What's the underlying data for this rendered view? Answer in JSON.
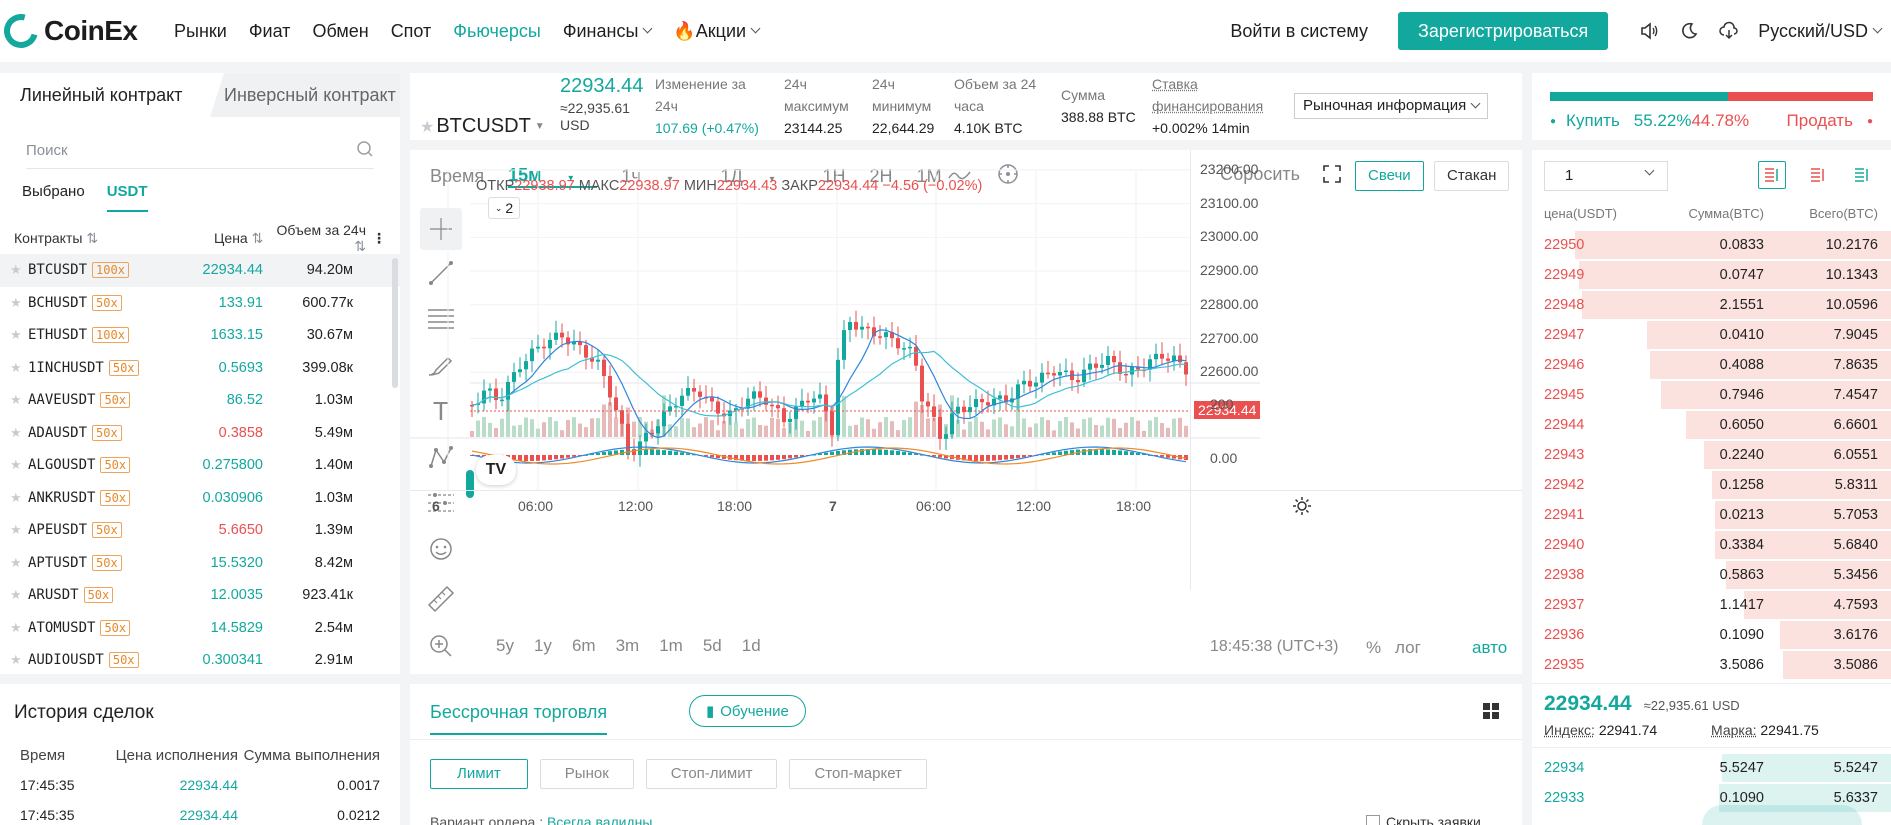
{
  "header": {
    "brand": "CoinEx",
    "nav": [
      {
        "label": "Рынки",
        "dropdown": false,
        "active": false
      },
      {
        "label": "Фиат",
        "dropdown": false,
        "active": false
      },
      {
        "label": "Обмен",
        "dropdown": false,
        "active": false
      },
      {
        "label": "Спот",
        "dropdown": false,
        "active": false
      },
      {
        "label": "Фьючерсы",
        "dropdown": false,
        "active": true
      },
      {
        "label": "Финансы",
        "dropdown": true,
        "active": false
      },
      {
        "label": "🔥Акции",
        "dropdown": true,
        "active": false
      }
    ],
    "login": "Войти в систему",
    "register": "Зарегистрироваться",
    "language": "Русский/USD",
    "icons": [
      "speaker-icon",
      "moon-icon",
      "download-icon"
    ]
  },
  "contracts": {
    "tab_linear": "Линейный контракт",
    "tab_inverse": "Инверсный контракт",
    "search_placeholder": "Поиск",
    "subtab_favorites": "Выбрано",
    "subtab_usdt": "USDT",
    "col_contracts": "Контракты",
    "col_price": "Цена",
    "col_volume": "Объем за 24ч",
    "rows": [
      {
        "symbol": "BTCUSDT",
        "leverage": "100x",
        "price": "22934.44",
        "dir": "green",
        "volume": "94.20м"
      },
      {
        "symbol": "BCHUSDT",
        "leverage": "50x",
        "price": "133.91",
        "dir": "green",
        "volume": "600.77к"
      },
      {
        "symbol": "ETHUSDT",
        "leverage": "100x",
        "price": "1633.15",
        "dir": "green",
        "volume": "30.67м"
      },
      {
        "symbol": "1INCHUSDT",
        "leverage": "50x",
        "price": "0.5693",
        "dir": "green",
        "volume": "399.08к"
      },
      {
        "symbol": "AAVEUSDT",
        "leverage": "50x",
        "price": "86.52",
        "dir": "green",
        "volume": "1.03м"
      },
      {
        "symbol": "ADAUSDT",
        "leverage": "50x",
        "price": "0.3858",
        "dir": "red",
        "volume": "5.49м"
      },
      {
        "symbol": "ALGOUSDT",
        "leverage": "50x",
        "price": "0.275800",
        "dir": "green",
        "volume": "1.40м"
      },
      {
        "symbol": "ANKRUSDT",
        "leverage": "50x",
        "price": "0.030906",
        "dir": "green",
        "volume": "1.03м"
      },
      {
        "symbol": "APEUSDT",
        "leverage": "50x",
        "price": "5.6650",
        "dir": "red",
        "volume": "1.39м"
      },
      {
        "symbol": "APTUSDT",
        "leverage": "50x",
        "price": "15.5320",
        "dir": "green",
        "volume": "8.42м"
      },
      {
        "symbol": "ARUSDT",
        "leverage": "50x",
        "price": "12.0035",
        "dir": "green",
        "volume": "923.41к"
      },
      {
        "symbol": "ATOMUSDT",
        "leverage": "50x",
        "price": "14.5829",
        "dir": "green",
        "volume": "2.54м"
      },
      {
        "symbol": "AUDIOUSDT",
        "leverage": "50x",
        "price": "0.300341",
        "dir": "green",
        "volume": "2.91м"
      }
    ]
  },
  "history": {
    "title": "История сделок",
    "col_time": "Время",
    "col_price": "Цена исполнения",
    "col_amount": "Сумма выполнения",
    "rows": [
      {
        "time": "17:45:35",
        "price": "22934.44",
        "amount": "0.0017"
      },
      {
        "time": "17:45:35",
        "price": "22934.44",
        "amount": "0.0212"
      }
    ]
  },
  "ticker": {
    "symbol": "BTCUSDT",
    "last": "22934.44",
    "last_usd": "≈22,935.61",
    "last_usd_unit": "USD",
    "change_label_1": "Изменение за",
    "change_label_2": "24ч",
    "change_value": "107.69 (+0.47%)",
    "high_label_1": "24ч",
    "high_label_2": "максимум",
    "high_value": "23144.25",
    "low_label_1": "24ч",
    "low_label_2": "минимум",
    "low_value": "22,644.29",
    "vol_label_1": "Объем за 24",
    "vol_label_2": "часа",
    "vol_value": "4.10K BTC",
    "sum_label": "Сумма",
    "sum_value": "388.88 BTC",
    "funding_label_1": "Ставка",
    "funding_label_2": "финансирования",
    "funding_value": "+0.002% 14min",
    "market_info": "Рыночная информация"
  },
  "chart_toolbar": {
    "time": "Время",
    "intervals": [
      "15м",
      "1ч",
      "1Д",
      "1Н",
      "2Н",
      "1М"
    ],
    "reset": "Сбросить",
    "candles": "Свечи",
    "depth": "Стакан"
  },
  "chart": {
    "ohlc_o_label": "ОТКР",
    "ohlc_o": "22938.97",
    "ohlc_h_label": "МАКС",
    "ohlc_h": "22938.97",
    "ohlc_l_label": "МИН",
    "ohlc_l": "22934.43",
    "ohlc_c_label": "ЗАКР",
    "ohlc_c": "22934.44",
    "ohlc_change": "−4.56 (−0.02%)",
    "indicator_badge": "2",
    "price_tag": "22934.44",
    "price_axis": [
      "23200.00",
      "23100.00",
      "23000.00",
      "22900.00",
      "22800.00",
      "22700.00",
      "22600.00"
    ],
    "volume_axis": "200",
    "macd_axis": "0.00",
    "time_axis": [
      "6",
      "06:00",
      "12:00",
      "18:00",
      "7",
      "06:00",
      "12:00",
      "18:00"
    ],
    "ranges": [
      "5y",
      "1y",
      "6m",
      "3m",
      "1m",
      "5d",
      "1d"
    ],
    "clock": "18:45:38 (UTC+3)",
    "pct": "%",
    "log": "лог",
    "auto": "авто",
    "colors": {
      "up": "#13a89e",
      "down": "#e9504f",
      "ma1": "#2e86de",
      "ma2": "#3ec1d3"
    }
  },
  "trade": {
    "tab": "Бессрочная торговля",
    "tutorial": "Обучение",
    "order_types": [
      "Лимит",
      "Рынок",
      "Стоп-лимит",
      "Стоп-маркет"
    ],
    "variant_label": "Вариант ордера :",
    "variant_value": "Всегда валидны",
    "hide_orders": "Скрыть заявки"
  },
  "sentiment": {
    "buy_label": "Купить",
    "buy_pct": "55.22%",
    "sell_pct": "44.78%",
    "sell_label": "Продать",
    "buy_ratio": 0.5522
  },
  "orderbook": {
    "precision": "1",
    "col_price": "цена(USDT)",
    "col_size": "Сумма(BTC)",
    "col_total": "Всего(BTC)",
    "asks": [
      {
        "price": "22950",
        "size": "0.0833",
        "total": "10.2176",
        "depth": 0.88
      },
      {
        "price": "22949",
        "size": "0.0747",
        "total": "10.1343",
        "depth": 0.87
      },
      {
        "price": "22948",
        "size": "2.1551",
        "total": "10.0596",
        "depth": 0.86
      },
      {
        "price": "22947",
        "size": "0.0410",
        "total": "7.9045",
        "depth": 0.68
      },
      {
        "price": "22946",
        "size": "0.4088",
        "total": "7.8635",
        "depth": 0.67
      },
      {
        "price": "22945",
        "size": "0.7946",
        "total": "7.4547",
        "depth": 0.64
      },
      {
        "price": "22944",
        "size": "0.6050",
        "total": "6.6601",
        "depth": 0.57
      },
      {
        "price": "22943",
        "size": "0.2240",
        "total": "6.0551",
        "depth": 0.52
      },
      {
        "price": "22942",
        "size": "0.1258",
        "total": "5.8311",
        "depth": 0.5
      },
      {
        "price": "22941",
        "size": "0.0213",
        "total": "5.7053",
        "depth": 0.49
      },
      {
        "price": "22940",
        "size": "0.3384",
        "total": "5.6840",
        "depth": 0.49
      },
      {
        "price": "22938",
        "size": "0.5863",
        "total": "5.3456",
        "depth": 0.46
      },
      {
        "price": "22937",
        "size": "1.1417",
        "total": "4.7593",
        "depth": 0.41
      },
      {
        "price": "22936",
        "size": "0.1090",
        "total": "3.6176",
        "depth": 0.31
      },
      {
        "price": "22935",
        "size": "3.5086",
        "total": "3.5086",
        "depth": 0.3
      }
    ],
    "mid_price": "22934.44",
    "mid_usd": "≈22,935.61",
    "mid_usd_unit": "USD",
    "index_label": "Индекс:",
    "index_value": "22941.74",
    "mark_label": "Марка:",
    "mark_value": "22941.75",
    "bids": [
      {
        "price": "22934",
        "size": "5.5247",
        "total": "5.5247",
        "depth": 0.47
      },
      {
        "price": "22933",
        "size": "0.1090",
        "total": "5.6337",
        "depth": 0.48
      }
    ]
  }
}
